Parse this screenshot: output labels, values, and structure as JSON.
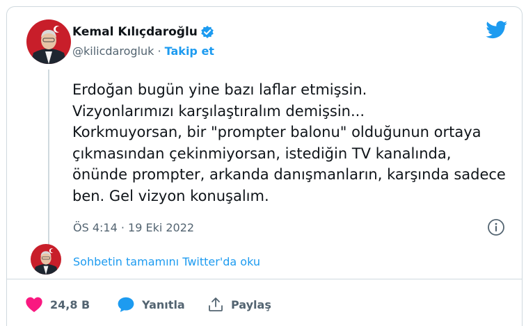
{
  "author": {
    "name": "Kemal Kılıçdaroğlu",
    "handle": "@kilicdarogluk",
    "separator": " · ",
    "follow_label": "Takip et"
  },
  "tweet": {
    "text": "Erdoğan bugün yine bazı laflar etmişsin.\nVizyonlarımızı karşılaştıralım demişsin...\nKorkmuyorsan, bir \"prompter balonu\" olduğunun ortaya çıkmasından çekinmiyorsan, istediğin TV kanalında, önünde prompter, arkanda danışmanların, karşında sadece ben. Gel vizyon konuşalım.",
    "timestamp": "ÖS 4:14 · 19 Eki 2022"
  },
  "thread": {
    "read_label": "Sohbetin tamamını Twitter'da oku"
  },
  "actions": {
    "like_count": "24,8 B",
    "reply_label": "Yanıtla",
    "share_label": "Paylaş"
  },
  "icons": {
    "verified": "verified-badge-icon",
    "brand": "twitter-bird-icon",
    "info": "info-icon",
    "like": "heart-icon",
    "reply": "speech-bubble-icon",
    "share": "share-icon"
  },
  "colors": {
    "accent": "#1d9bf0",
    "like": "#f91880",
    "text": "#0f1419",
    "muted": "#536471",
    "border": "#cfd9de"
  }
}
